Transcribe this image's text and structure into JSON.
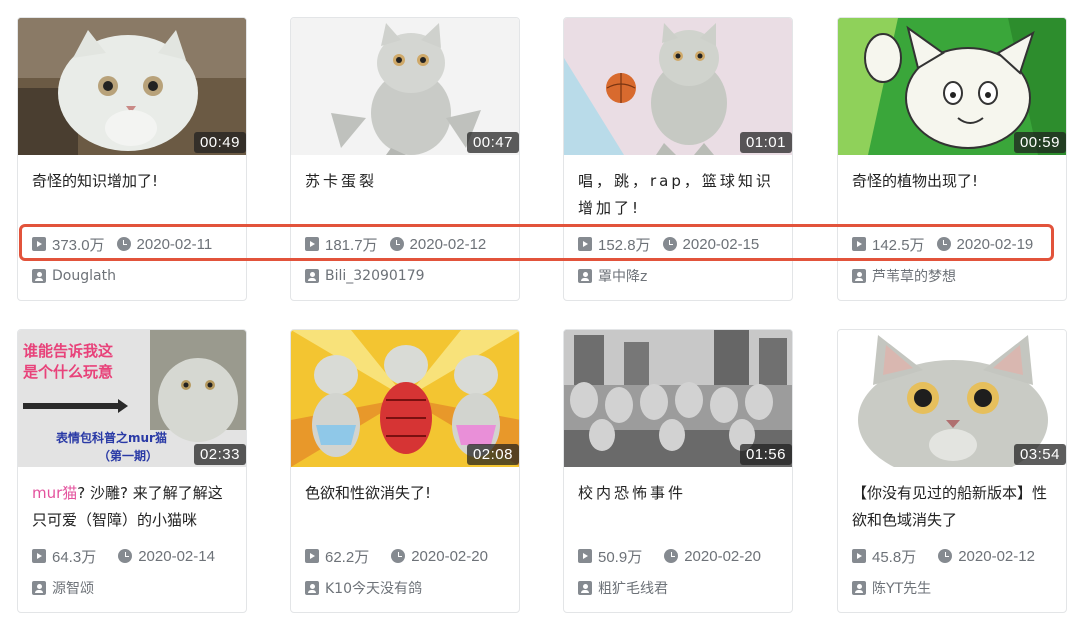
{
  "colors": {
    "highlight": "#e2533b",
    "title_highlight": "#e3529d",
    "meta": "#6d7278"
  },
  "cards": [
    {
      "title": "奇怪的知识增加了!",
      "duration": "00:49",
      "views": "373.0万",
      "date": "2020-02-11",
      "author": "Douglath"
    },
    {
      "title": "苏卡蛋裂",
      "duration": "00:47",
      "views": "181.7万",
      "date": "2020-02-12",
      "author": "Bili_32090179"
    },
    {
      "title": "唱，跳，rap，篮球知识增加了!",
      "duration": "01:01",
      "views": "152.8万",
      "date": "2020-02-15",
      "author": "罩中降z"
    },
    {
      "title": "奇怪的植物出现了!",
      "duration": "00:59",
      "views": "142.5万",
      "date": "2020-02-19",
      "author": "芦苇草的梦想"
    },
    {
      "title_highlight": "mur猫",
      "title": "? 沙雕? 来了解了解这只可爱（智障）的小猫咪",
      "duration": "02:33",
      "views": "64.3万",
      "date": "2020-02-14",
      "author": "源智颂",
      "thumb_text": {
        "line1": "谁能告诉我这",
        "line2": "是个什么玩意",
        "line3": "表情包科普之mur猫",
        "line4": "（第一期）"
      }
    },
    {
      "title": "色欲和性欲消失了!",
      "duration": "02:08",
      "views": "62.2万",
      "date": "2020-02-20",
      "author": "K10今天没有鸽"
    },
    {
      "title": "校内恐怖事件",
      "duration": "01:56",
      "views": "50.9万",
      "date": "2020-02-20",
      "author": "粗犷毛线君"
    },
    {
      "title": "【你没有见过的船新版本】性欲和色域消失了",
      "duration": "03:54",
      "views": "45.8万",
      "date": "2020-02-12",
      "author": "陈YT先生"
    }
  ]
}
